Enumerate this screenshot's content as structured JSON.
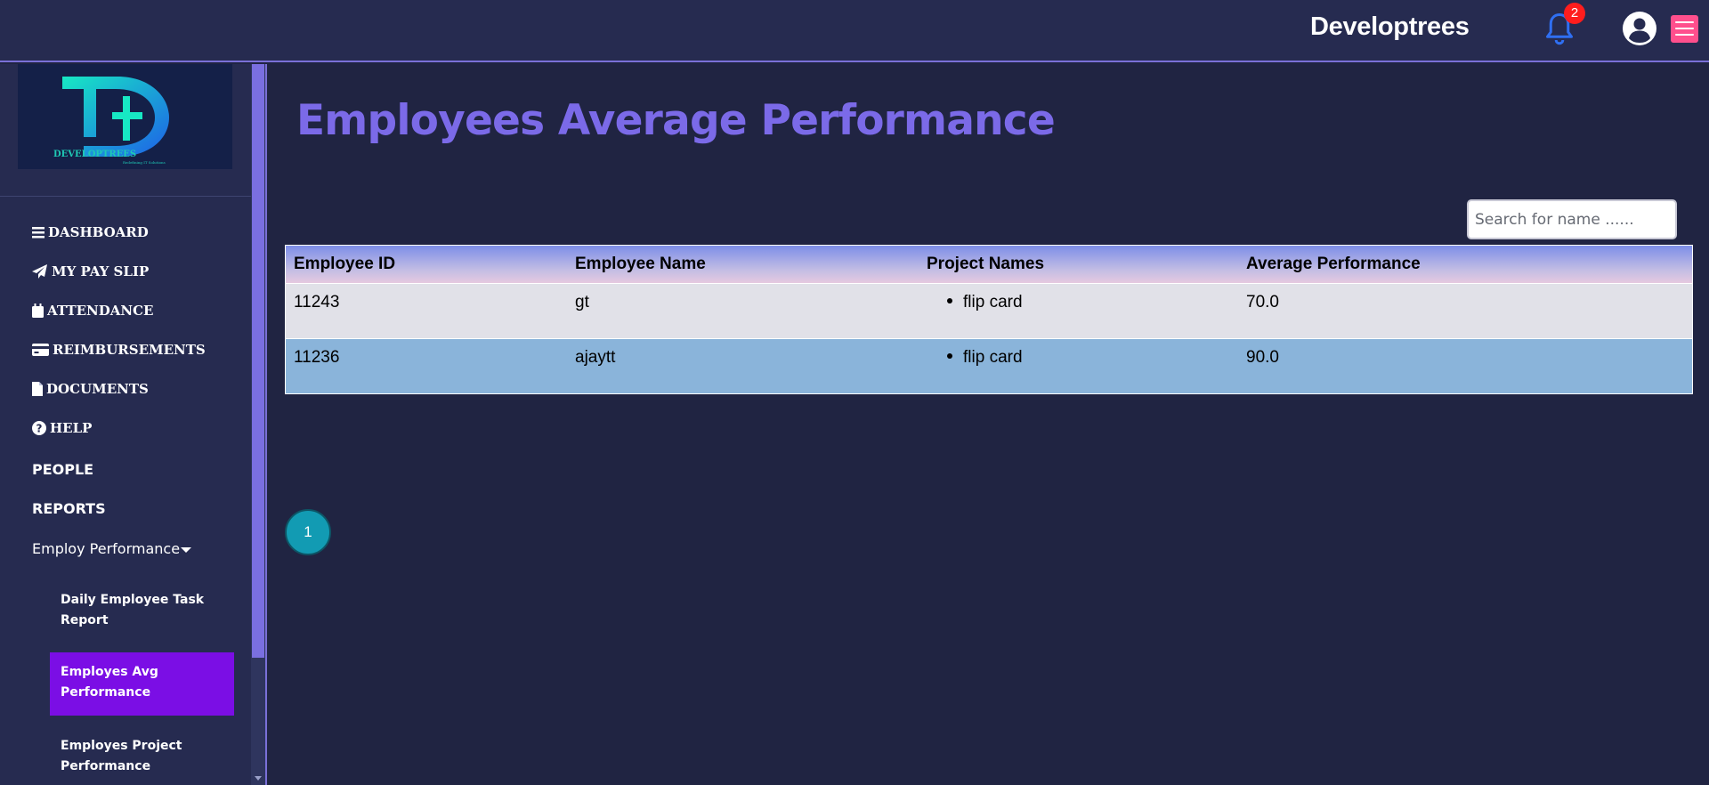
{
  "header": {
    "brand": "Developtrees",
    "notification_count": "2",
    "bell_icon": "bell-icon",
    "avatar_icon": "user-circle-icon",
    "menu_icon": "hamburger-icon",
    "accent_color": "#ff4f8d"
  },
  "sidebar": {
    "logo_text": "DEVELOPTREES",
    "logo_tagline": "Redefining IT Solutions",
    "items": [
      {
        "label": "DASHBOARD",
        "icon": "bars-icon"
      },
      {
        "label": "MY PAY SLIP",
        "icon": "paper-plane-icon"
      },
      {
        "label": "ATTENDANCE",
        "icon": "calendar-icon"
      },
      {
        "label": "REIMBURSEMENTS",
        "icon": "credit-card-icon"
      },
      {
        "label": "DOCUMENTS",
        "icon": "file-icon"
      },
      {
        "label": "HELP",
        "icon": "question-circle-icon"
      },
      {
        "label": "PEOPLE"
      },
      {
        "label": "REPORTS"
      },
      {
        "label": "Employ Performance"
      }
    ],
    "submenu": [
      {
        "label": "Daily Employee Task Report"
      },
      {
        "label": "Employes Avg Performance"
      },
      {
        "label": "Employes Project Performance"
      }
    ],
    "active_color": "#7b0ee5"
  },
  "main": {
    "title": "Employees Average Performance",
    "search_placeholder": "Search for name ......",
    "table": {
      "headers": [
        "Employee ID",
        "Employee Name",
        "Project Names",
        "Average Performance"
      ],
      "rows": [
        {
          "id": "11243",
          "name": "gt",
          "projects": [
            "flip card"
          ],
          "avg": "70.0"
        },
        {
          "id": "11236",
          "name": "ajaytt",
          "projects": [
            "flip card"
          ],
          "avg": "90.0"
        }
      ]
    },
    "pagination": {
      "current_page": "1"
    }
  }
}
